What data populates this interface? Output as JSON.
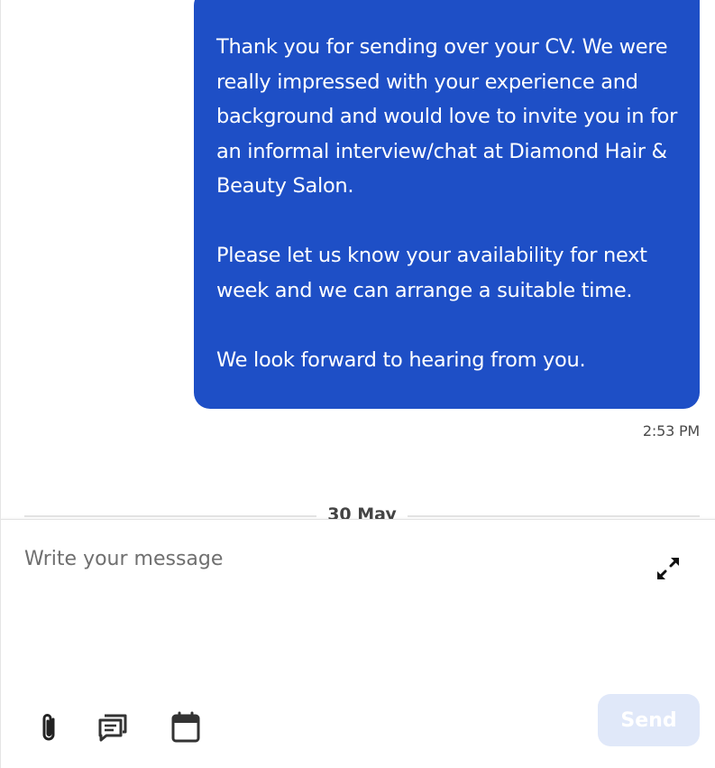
{
  "thread": {
    "message": {
      "paragraphs": [
        "Thank you for sending over your CV. We were really impressed with your experience and background and would love to invite you in for an informal interview/chat at Diamond Hair & Beauty Salon.",
        "Please let us know your availability for next week and we can arrange a suitable time.",
        "We look forward to hearing from you."
      ],
      "time": "2:53 PM",
      "bubble_color": "#1e4fc6"
    },
    "date_divider": "30 May"
  },
  "composer": {
    "placeholder": "Write your message",
    "value": "",
    "send_label": "Send",
    "send_disabled_color": "#e0e8f9",
    "icons": {
      "expand": "expand-icon",
      "attach": "paperclip-icon",
      "templates": "message-templates-icon",
      "schedule": "calendar-icon"
    }
  }
}
